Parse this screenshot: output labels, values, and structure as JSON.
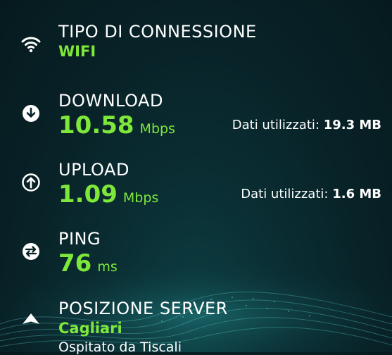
{
  "connection": {
    "label": "TIPO DI CONNESSIONE",
    "value": "WIFI",
    "icon": "wifi-icon"
  },
  "download": {
    "label": "DOWNLOAD",
    "value": "10.58",
    "unit": "Mbps",
    "data_used_label": "Dati utilizzati:",
    "data_used_value": "19.3 MB",
    "icon": "download-arrow-icon"
  },
  "upload": {
    "label": "UPLOAD",
    "value": "1.09",
    "unit": "Mbps",
    "data_used_label": "Dati utilizzati:",
    "data_used_value": "1.6 MB",
    "icon": "upload-arrow-icon"
  },
  "ping": {
    "label": "PING",
    "value": "76",
    "unit": "ms",
    "icon": "ping-icon"
  },
  "server": {
    "label": "POSIZIONE SERVER",
    "city": "Cagliari",
    "host": "Ospitato da Tiscali",
    "icon": "location-triangle-icon"
  },
  "colors": {
    "accent": "#7ee83a",
    "background": "#082227",
    "text": "#ffffff"
  }
}
